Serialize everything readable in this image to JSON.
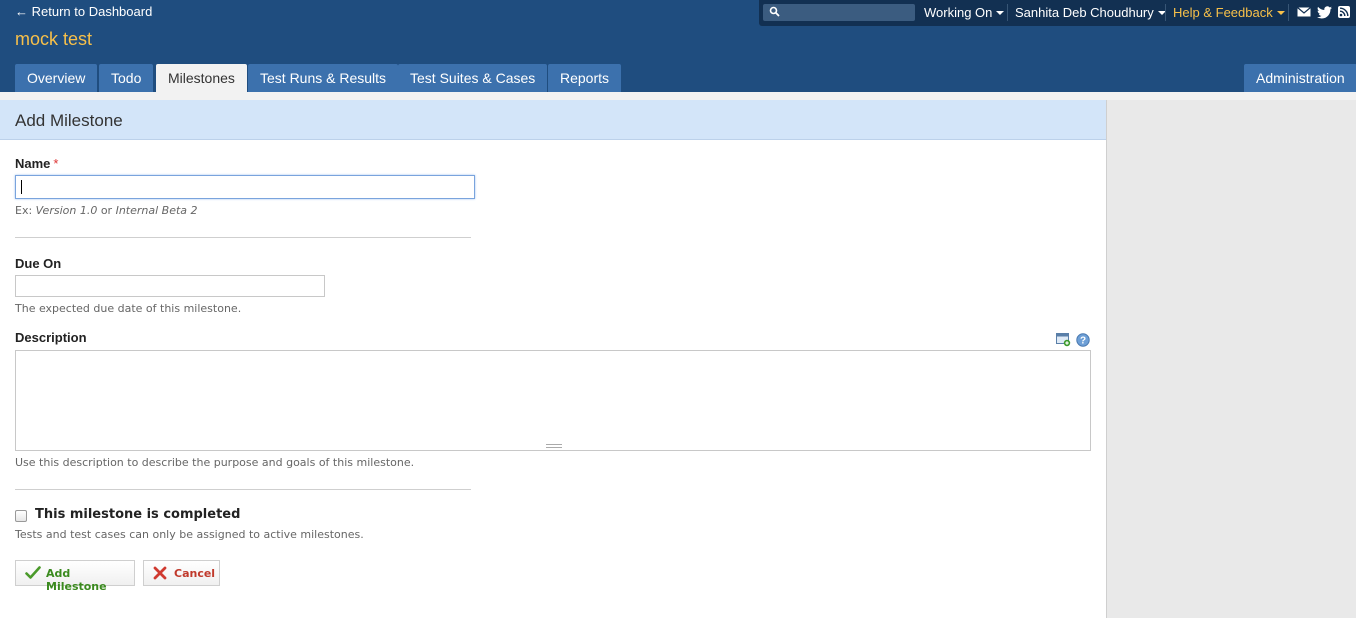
{
  "header": {
    "return_link": "← Return to Dashboard",
    "project_title": "mock test",
    "search_placeholder": "",
    "working_on": "Working On",
    "user_name": "Sanhita Deb Choudhury",
    "help": "Help & Feedback",
    "icons": [
      "mail-icon",
      "twitter-icon",
      "rss-icon"
    ]
  },
  "tabs": [
    {
      "label": "Overview",
      "active": false
    },
    {
      "label": "Todo",
      "active": false
    },
    {
      "label": "Milestones",
      "active": true
    },
    {
      "label": "Test Runs & Results",
      "active": false
    },
    {
      "label": "Test Suites & Cases",
      "active": false
    },
    {
      "label": "Reports",
      "active": false
    }
  ],
  "admin_tab": "Administration",
  "page_title": "Add Milestone",
  "form": {
    "name_label": "Name",
    "required_mark": "*",
    "name_value": "",
    "name_hint_prefix": "Ex: ",
    "name_hint_example1": "Version 1.0",
    "name_hint_or": " or ",
    "name_hint_example2": "Internal Beta 2",
    "due_label": "Due On",
    "due_value": "",
    "due_hint": "The expected due date of this milestone.",
    "description_label": "Description",
    "description_value": "",
    "description_hint": "Use this description to describe the purpose and goals of this milestone.",
    "completed_label": "This milestone is completed",
    "completed_checked": false,
    "completed_hint": "Tests and test cases can only be assigned to active milestones.",
    "submit_label": "Add Milestone",
    "cancel_label": "Cancel"
  },
  "colors": {
    "header_bg": "#1f4d7f",
    "accent_yellow": "#f7c04a",
    "tab_bg": "#3c71ad",
    "content_header_bg": "#d3e5f9",
    "submit_text": "#3a8a1e",
    "cancel_text": "#c0392b"
  }
}
